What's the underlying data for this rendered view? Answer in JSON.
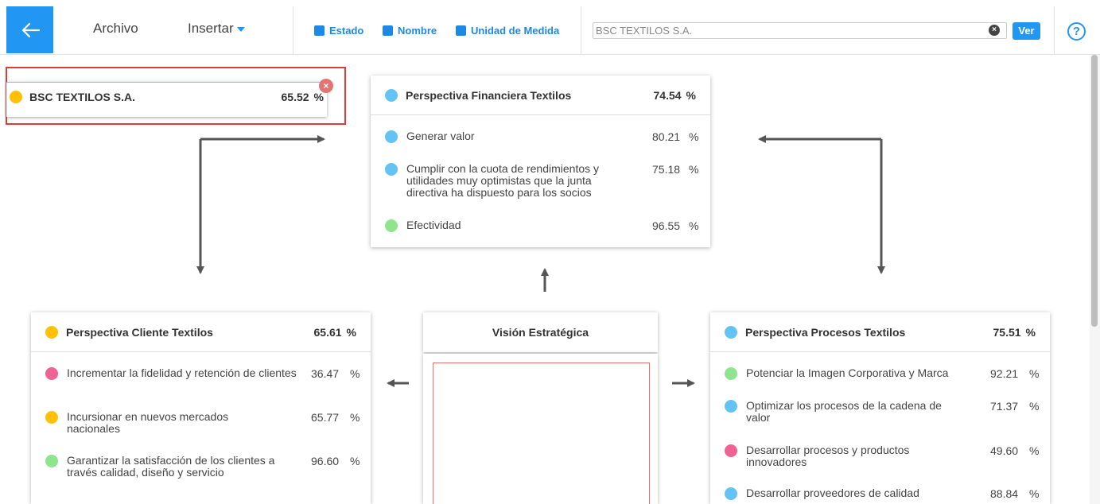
{
  "toolbar": {
    "menu_archivo": "Archivo",
    "menu_insertar": "Insertar",
    "filters": {
      "estado": "Estado",
      "nombre": "Nombre",
      "unidad": "Unidad de Medida"
    },
    "search_value": "BSC TEXTILOS S.A.",
    "ver_label": "Ver",
    "help_glyph": "?",
    "clear_glyph": "×"
  },
  "colors": {
    "accent": "#2196f3",
    "status_yellow": "#ffc107",
    "status_blue": "#64c3f5",
    "status_green": "#8ee58e",
    "status_pink": "#f06292",
    "selection": "#e53935"
  },
  "root_node": {
    "name": "BSC TEXTILOS S.A.",
    "value": "65.52",
    "unit": "%",
    "status": "yellow",
    "remove_glyph": "×"
  },
  "perspectives": {
    "financiera": {
      "title": "Perspectiva Financiera Textilos",
      "value": "74.54",
      "unit": "%",
      "status": "blue",
      "objectives": [
        {
          "text": "Generar valor",
          "value": "80.21",
          "unit": "%",
          "status": "blue"
        },
        {
          "text": "Cumplir con la cuota de rendimientos y utilidades muy optimistas que la junta directiva ha dispuesto para los socios",
          "value": "75.18",
          "unit": "%",
          "status": "blue"
        },
        {
          "text": "Efectividad",
          "value": "96.55",
          "unit": "%",
          "status": "green"
        }
      ]
    },
    "cliente": {
      "title": "Perspectiva Cliente Textilos",
      "value": "65.61",
      "unit": "%",
      "status": "yellow",
      "objectives": [
        {
          "text": "Incrementar la fidelidad y retención de clientes",
          "value": "36.47",
          "unit": "%",
          "status": "pink"
        },
        {
          "text": "Incursionar en nuevos mercados nacionales",
          "value": "65.77",
          "unit": "%",
          "status": "yellow"
        },
        {
          "text": "Garantizar la satisfacción de los clientes a través calidad, diseño y servicio",
          "value": "96.60",
          "unit": "%",
          "status": "green"
        }
      ]
    },
    "procesos": {
      "title": "Perspectiva Procesos Textilos",
      "value": "75.51",
      "unit": "%",
      "status": "blue",
      "objectives": [
        {
          "text": "Potenciar la Imagen Corporativa y Marca",
          "value": "92.21",
          "unit": "%",
          "status": "green"
        },
        {
          "text": "Optimizar los procesos de la cadena de valor",
          "value": "71.37",
          "unit": "%",
          "status": "blue"
        },
        {
          "text": "Desarrollar procesos y productos innovadores",
          "value": "49.60",
          "unit": "%",
          "status": "pink"
        },
        {
          "text": "Desarrollar proveedores de calidad",
          "value": "88.84",
          "unit": "%",
          "status": "blue"
        }
      ]
    }
  },
  "vision": {
    "title": "Visión Estratégica"
  }
}
